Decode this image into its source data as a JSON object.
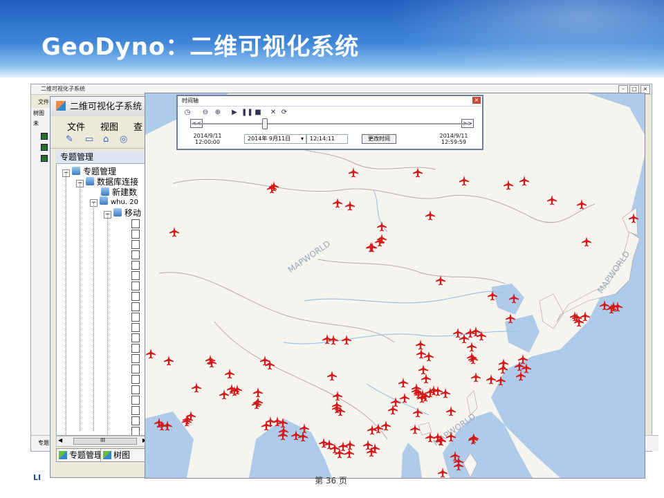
{
  "slide": {
    "title": "GeoDyno：二维可视化系统",
    "footer": "第 36 页",
    "logo_text": "LI"
  },
  "bg_window": {
    "title": "二维可视化子系统",
    "menu": "文件",
    "side_label": "树图",
    "side_label2": "未",
    "status_label": "专题"
  },
  "app_window": {
    "title": "二维可视化子系统",
    "menu": [
      "文件",
      "视图",
      "查"
    ],
    "panel_header": "专题管理",
    "tree": {
      "root": "专题管理",
      "db": "数据库连接",
      "new_db": "新建数",
      "whu": "whu. 20",
      "move": "移动"
    },
    "scroll_text": "III",
    "tabs": [
      "专题管理",
      "树图"
    ]
  },
  "time_dialog": {
    "title": "时间轴",
    "start_date": "2014/9/11",
    "start_time": "12:00:00",
    "end_date": "2014/9/11",
    "end_time": "12:59:59",
    "date_field": "2014年 9月11日",
    "time_field": "12:14:11",
    "change_button": "更改时间",
    "prev_label": "<<",
    "next_label": ">>"
  },
  "map": {
    "watermark": "MAPWORLD",
    "land_color": "#f6f4ee",
    "sea_color": "#aecbe9",
    "plane_color": "#d21a1a",
    "icon": "airplane-icon"
  }
}
